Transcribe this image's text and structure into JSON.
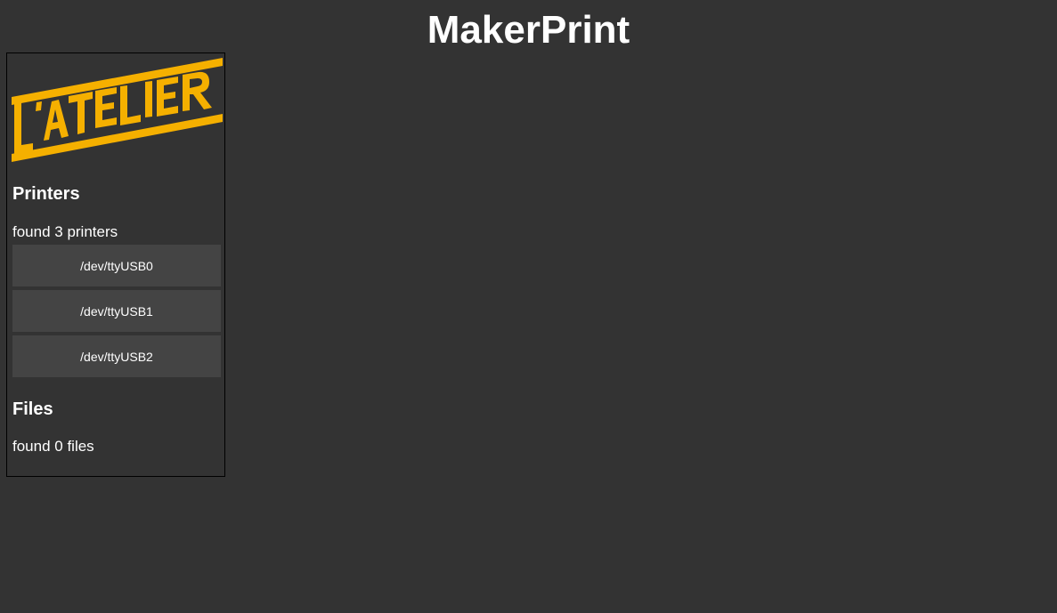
{
  "app": {
    "title": "MakerPrint"
  },
  "logo": {
    "text": "L'ATELIER",
    "color": "#f5b000"
  },
  "printers": {
    "heading": "Printers",
    "count_text": "found 3 printers",
    "items": [
      {
        "label": "/dev/ttyUSB0"
      },
      {
        "label": "/dev/ttyUSB1"
      },
      {
        "label": "/dev/ttyUSB2"
      }
    ]
  },
  "files": {
    "heading": "Files",
    "count_text": "found 0 files",
    "items": []
  },
  "colors": {
    "background": "#333333",
    "button": "#444444",
    "text": "#ffffff",
    "accent": "#f5b000"
  }
}
